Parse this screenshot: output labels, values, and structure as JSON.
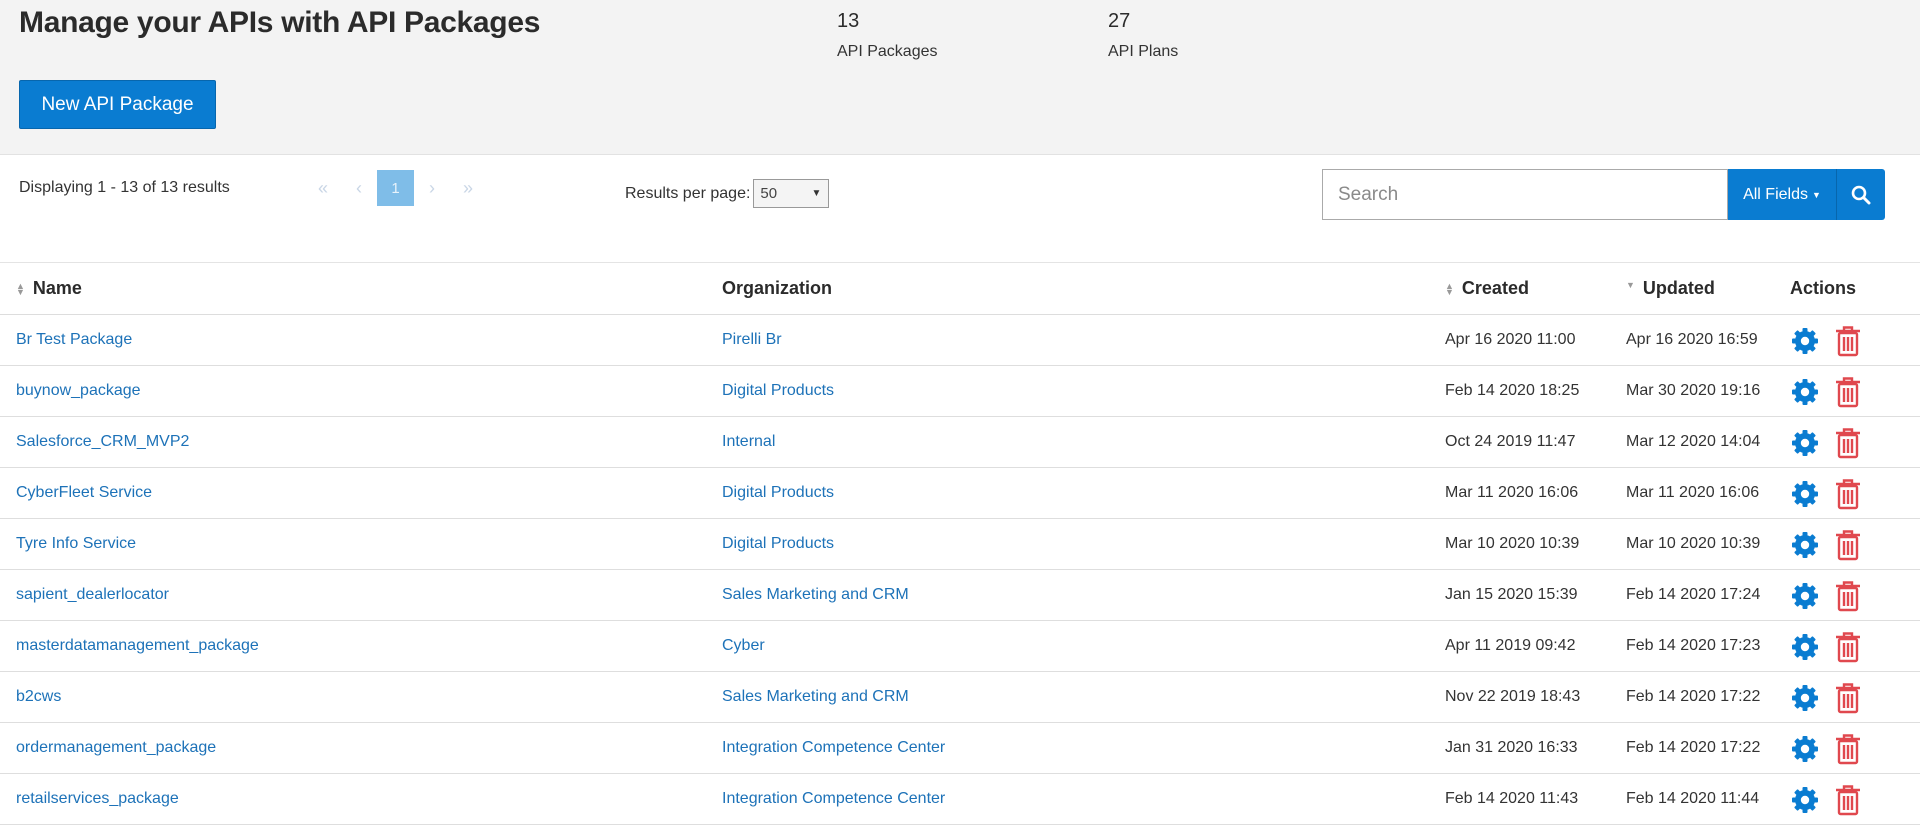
{
  "header": {
    "title": "Manage your APIs with API Packages",
    "new_button": "New API Package",
    "stats": [
      {
        "value": "13",
        "label": "API Packages"
      },
      {
        "value": "27",
        "label": "API Plans"
      }
    ]
  },
  "toolbar": {
    "displaying": "Displaying 1 - 13 of 13 results",
    "current_page": "1",
    "results_per_page_label": "Results per page:",
    "results_per_page_value": "50",
    "search_placeholder": "Search",
    "fields_button": "All Fields",
    "colors": {
      "accent": "#0a7cd1",
      "link": "#1d72b8",
      "delete": "#e0484e"
    }
  },
  "table": {
    "columns": [
      "Name",
      "Organization",
      "Created",
      "Updated",
      "Actions"
    ],
    "rows": [
      {
        "name": "Br Test Package",
        "org": "Pirelli Br",
        "created": "Apr 16 2020 11:00",
        "updated": "Apr 16 2020 16:59"
      },
      {
        "name": "buynow_package",
        "org": "Digital Products",
        "created": "Feb 14 2020 18:25",
        "updated": "Mar 30 2020 19:16"
      },
      {
        "name": "Salesforce_CRM_MVP2",
        "org": "Internal",
        "created": "Oct 24 2019 11:47",
        "updated": "Mar 12 2020 14:04"
      },
      {
        "name": "CyberFleet Service",
        "org": "Digital Products",
        "created": "Mar 11 2020 16:06",
        "updated": "Mar 11 2020 16:06"
      },
      {
        "name": "Tyre Info Service",
        "org": "Digital Products",
        "created": "Mar 10 2020 10:39",
        "updated": "Mar 10 2020 10:39"
      },
      {
        "name": "sapient_dealerlocator",
        "org": "Sales Marketing and CRM",
        "created": "Jan 15 2020 15:39",
        "updated": "Feb 14 2020 17:24"
      },
      {
        "name": "masterdatamanagement_package",
        "org": "Cyber",
        "created": "Apr 11 2019 09:42",
        "updated": "Feb 14 2020 17:23"
      },
      {
        "name": "b2cws",
        "org": "Sales Marketing and CRM",
        "created": "Nov 22 2019 18:43",
        "updated": "Feb 14 2020 17:22"
      },
      {
        "name": "ordermanagement_package",
        "org": "Integration Competence Center",
        "created": "Jan 31 2020 16:33",
        "updated": "Feb 14 2020 17:22"
      },
      {
        "name": "retailservices_package",
        "org": "Integration Competence Center",
        "created": "Feb 14 2020 11:43",
        "updated": "Feb 14 2020 11:44"
      }
    ]
  }
}
